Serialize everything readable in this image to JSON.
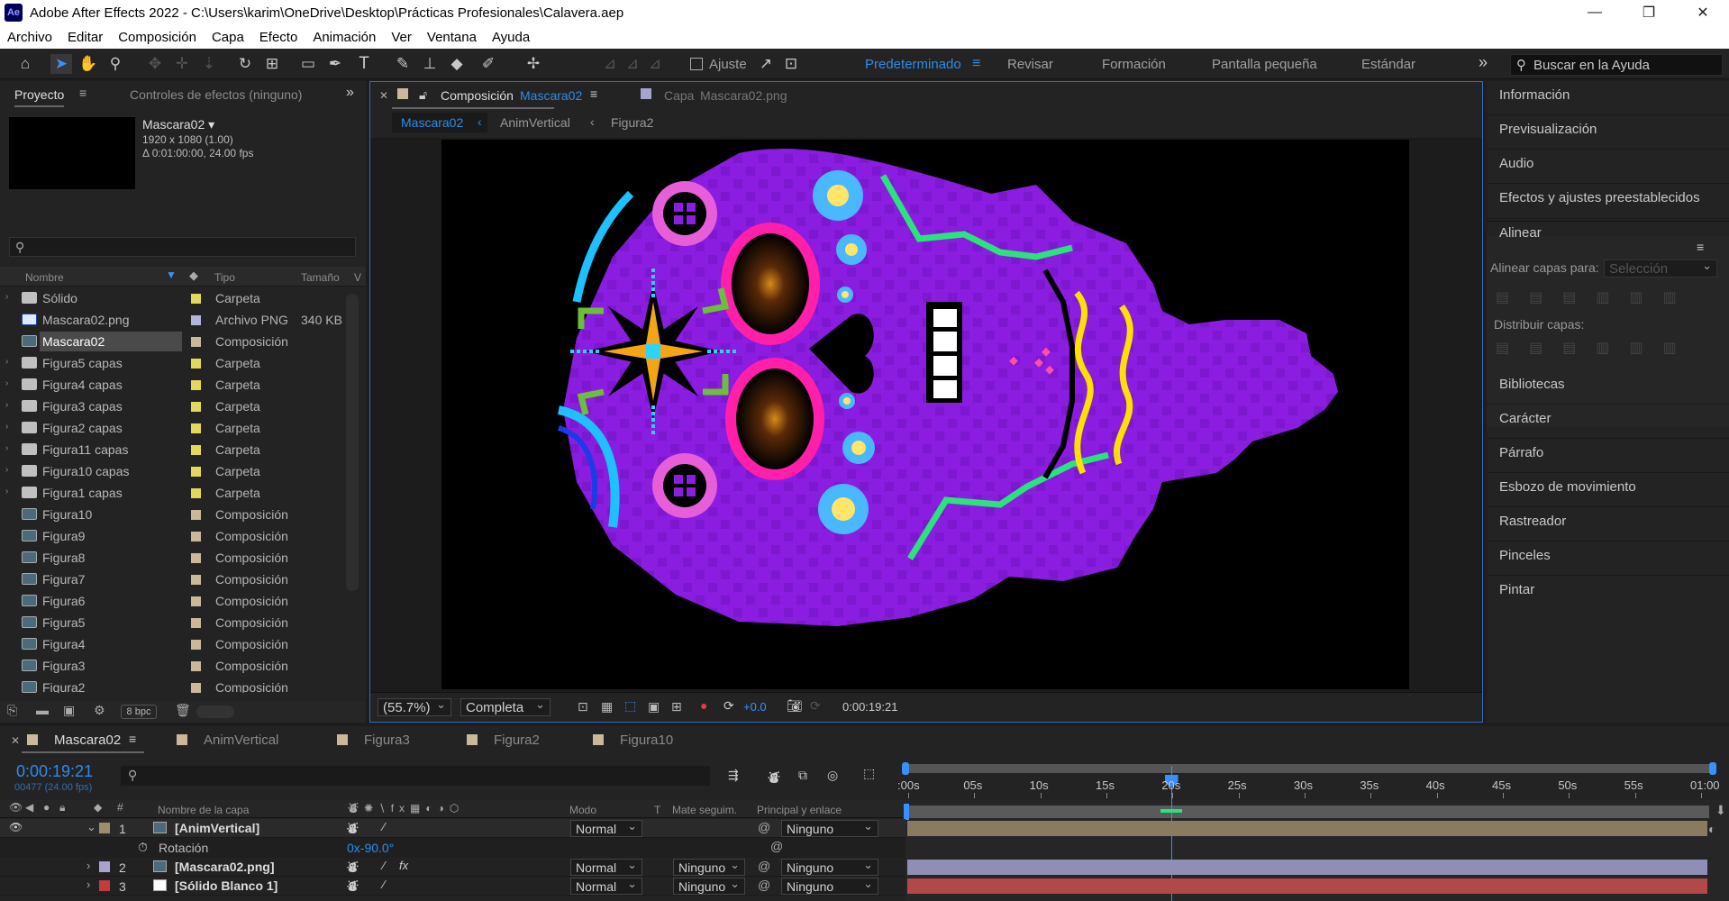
{
  "window": {
    "title": "Adobe After Effects 2022 - C:\\Users\\karim\\OneDrive\\Desktop\\Prácticas Profesionales\\Calavera.aep",
    "logo": "Ae",
    "minimize": "—",
    "maximize": "❐",
    "close": "✕"
  },
  "menu": [
    "Archivo",
    "Editar",
    "Composición",
    "Capa",
    "Efecto",
    "Animación",
    "Ver",
    "Ventana",
    "Ayuda"
  ],
  "toolbar": {
    "snap_label": "Ajuste",
    "workspaces": [
      "Predeterminado",
      "Revisar",
      "Formación",
      "Pantalla pequeña",
      "Estándar"
    ],
    "active_workspace": "Predeterminado",
    "overflow": "»",
    "search_placeholder": "Buscar en la Ayuda"
  },
  "project": {
    "tab_project": "Proyecto",
    "tab_effects": "Controles de efectos (ninguno)",
    "selected_name": "Mascara02 ▾",
    "selected_res": "1920 x 1080 (1.00)",
    "selected_dur": "Δ 0:01:00:00, 24.00 fps",
    "col_name": "Nombre",
    "col_type": "Tipo",
    "col_size": "Tamaño",
    "col_v": "V",
    "items": [
      {
        "name": "Sólido",
        "type": "Carpeta",
        "size": "",
        "icon": "folder",
        "label": "#e4d85a",
        "twirl": true
      },
      {
        "name": "Mascara02.png",
        "type": "Archivo PNG",
        "size": "340 KB",
        "icon": "png",
        "label": "#b3b3e0",
        "twirl": false
      },
      {
        "name": "Mascara02",
        "type": "Composición",
        "size": "",
        "icon": "comp",
        "label": "#c9b89a",
        "twirl": false,
        "selected": true
      },
      {
        "name": "Figura5 capas",
        "type": "Carpeta",
        "size": "",
        "icon": "folder",
        "label": "#e4d85a",
        "twirl": true
      },
      {
        "name": "Figura4 capas",
        "type": "Carpeta",
        "size": "",
        "icon": "folder",
        "label": "#e4d85a",
        "twirl": true
      },
      {
        "name": "Figura3 capas",
        "type": "Carpeta",
        "size": "",
        "icon": "folder",
        "label": "#e4d85a",
        "twirl": true
      },
      {
        "name": "Figura2 capas",
        "type": "Carpeta",
        "size": "",
        "icon": "folder",
        "label": "#e4d85a",
        "twirl": true
      },
      {
        "name": "Figura11 capas",
        "type": "Carpeta",
        "size": "",
        "icon": "folder",
        "label": "#e4d85a",
        "twirl": true
      },
      {
        "name": "Figura10 capas",
        "type": "Carpeta",
        "size": "",
        "icon": "folder",
        "label": "#e4d85a",
        "twirl": true
      },
      {
        "name": "Figura1 capas",
        "type": "Carpeta",
        "size": "",
        "icon": "folder",
        "label": "#e4d85a",
        "twirl": true
      },
      {
        "name": "Figura10",
        "type": "Composición",
        "size": "",
        "icon": "comp",
        "label": "#c9b89a",
        "twirl": false
      },
      {
        "name": "Figura9",
        "type": "Composición",
        "size": "",
        "icon": "comp",
        "label": "#c9b89a",
        "twirl": false
      },
      {
        "name": "Figura8",
        "type": "Composición",
        "size": "",
        "icon": "comp",
        "label": "#c9b89a",
        "twirl": false
      },
      {
        "name": "Figura7",
        "type": "Composición",
        "size": "",
        "icon": "comp",
        "label": "#c9b89a",
        "twirl": false
      },
      {
        "name": "Figura6",
        "type": "Composición",
        "size": "",
        "icon": "comp",
        "label": "#c9b89a",
        "twirl": false
      },
      {
        "name": "Figura5",
        "type": "Composición",
        "size": "",
        "icon": "comp",
        "label": "#c9b89a",
        "twirl": false
      },
      {
        "name": "Figura4",
        "type": "Composición",
        "size": "",
        "icon": "comp",
        "label": "#c9b89a",
        "twirl": false
      },
      {
        "name": "Figura3",
        "type": "Composición",
        "size": "",
        "icon": "comp",
        "label": "#c9b89a",
        "twirl": false
      },
      {
        "name": "Figura2",
        "type": "Composición",
        "size": "",
        "icon": "comp",
        "label": "#c9b89a",
        "twirl": false
      }
    ],
    "bpc": "8 bpc"
  },
  "composition": {
    "tab_label": "Composición",
    "tab_name": "Mascara02",
    "layer_tab_label": "Capa",
    "layer_tab_name": "Mascara02.png",
    "breadcrumb": [
      "Mascara02",
      "AnimVertical",
      "Figura2"
    ],
    "zoom": "(55.7%)",
    "resolution": "Completa",
    "exposure": "+0.0",
    "timecode": "0:00:19:21"
  },
  "right_panels": [
    "Información",
    "Previsualización",
    "Audio",
    "Efectos y ajustes preestablecidos",
    "Alinear",
    "Bibliotecas",
    "Carácter",
    "Párrafo",
    "Esbozo de movimiento",
    "Rastreador",
    "Pinceles",
    "Pintar"
  ],
  "align": {
    "align_to_label": "Alinear capas para:",
    "align_to_value": "Selección",
    "distribute_label": "Distribuir capas:"
  },
  "timeline": {
    "tabs": [
      "Mascara02",
      "AnimVertical",
      "Figura3",
      "Figura2",
      "Figura10"
    ],
    "timecode": "0:00:19:21",
    "frame_info": "00477 (24.00 fps)",
    "col_layer_name": "Nombre de la capa",
    "col_mode": "Modo",
    "col_t": "T",
    "col_track": "Mate seguim.",
    "col_parent": "Principal y enlace",
    "ruler": [
      ":00s",
      "05s",
      "10s",
      "15s",
      "20s",
      "25s",
      "30s",
      "35s",
      "40s",
      "45s",
      "50s",
      "55s",
      "01:00"
    ],
    "playhead_seconds": 19.875,
    "layers": [
      {
        "num": "1",
        "name": "[AnimVertical]",
        "mode": "Normal",
        "track": "",
        "parent": "Ninguno",
        "label": "#9e8c6c",
        "bar": "#8a7a60"
      },
      {
        "num": "2",
        "name": "[Mascara02.png]",
        "mode": "Normal",
        "track": "Ninguno",
        "parent": "Ninguno",
        "label": "#a5a5cf",
        "bar": "#8f8fb5"
      },
      {
        "num": "3",
        "name": "[Sólido Blanco 1]",
        "mode": "Normal",
        "track": "Ninguno",
        "parent": "Ninguno",
        "label": "#c43b3b",
        "bar": "#b24848"
      }
    ],
    "rotation_label": "Rotación",
    "rotation_value": "0x-90.0°"
  }
}
